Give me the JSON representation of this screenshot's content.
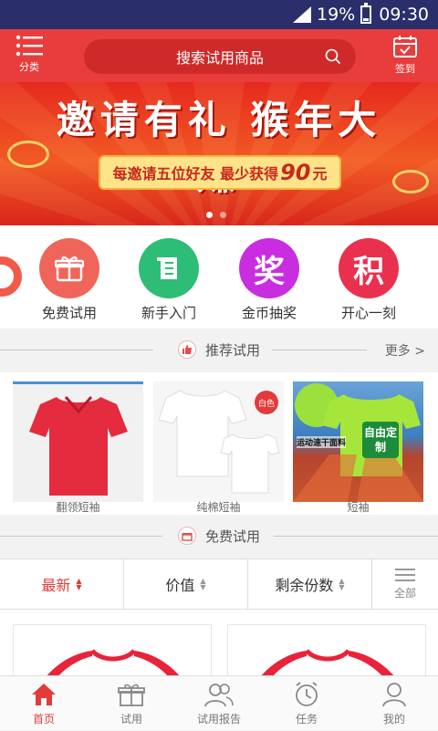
{
  "status_bar": {
    "battery": "19%",
    "time": "09:30"
  },
  "header": {
    "category_label": "分类",
    "search_placeholder": "搜索试用商品",
    "checkin_label": "签到"
  },
  "banner": {
    "title": "邀请有礼 猴年大赚",
    "sub_prefix": "每邀请五位好友 最少获得",
    "sub_amount": "90",
    "sub_suffix": "元"
  },
  "quick_menu": [
    {
      "label": "免费试用",
      "icon": "gift-icon",
      "color": "#f0655a"
    },
    {
      "label": "新手入门",
      "icon": "scroll-icon",
      "color": "#2dbd76"
    },
    {
      "label": "金币抽奖",
      "icon": "jiang-icon",
      "color": "#c82ee0",
      "glyph": "奖"
    },
    {
      "label": "开心一刻",
      "icon": "ji-icon",
      "color": "#e9314f",
      "glyph": "积"
    }
  ],
  "recommended": {
    "title": "推荐试用",
    "more": "更多 >",
    "items": [
      {
        "caption": "翻领短袖"
      },
      {
        "caption": "纯棉短袖",
        "tag": "白色"
      },
      {
        "caption": "短袖",
        "promo": "自由定制",
        "note": "运动速干面料"
      }
    ]
  },
  "free_section": {
    "title": "免费试用"
  },
  "sort_tabs": [
    {
      "label": "最新",
      "active": true
    },
    {
      "label": "价值",
      "active": false
    },
    {
      "label": "剩余份数",
      "active": false
    }
  ],
  "all_label": "全部",
  "bottom_nav": [
    {
      "label": "首页",
      "active": true
    },
    {
      "label": "试用",
      "active": false
    },
    {
      "label": "试用报告",
      "active": false
    },
    {
      "label": "任务",
      "active": false
    },
    {
      "label": "我的",
      "active": false
    }
  ],
  "colors": {
    "primary": "#e93c3c",
    "status_bar": "#2a2f6b"
  }
}
